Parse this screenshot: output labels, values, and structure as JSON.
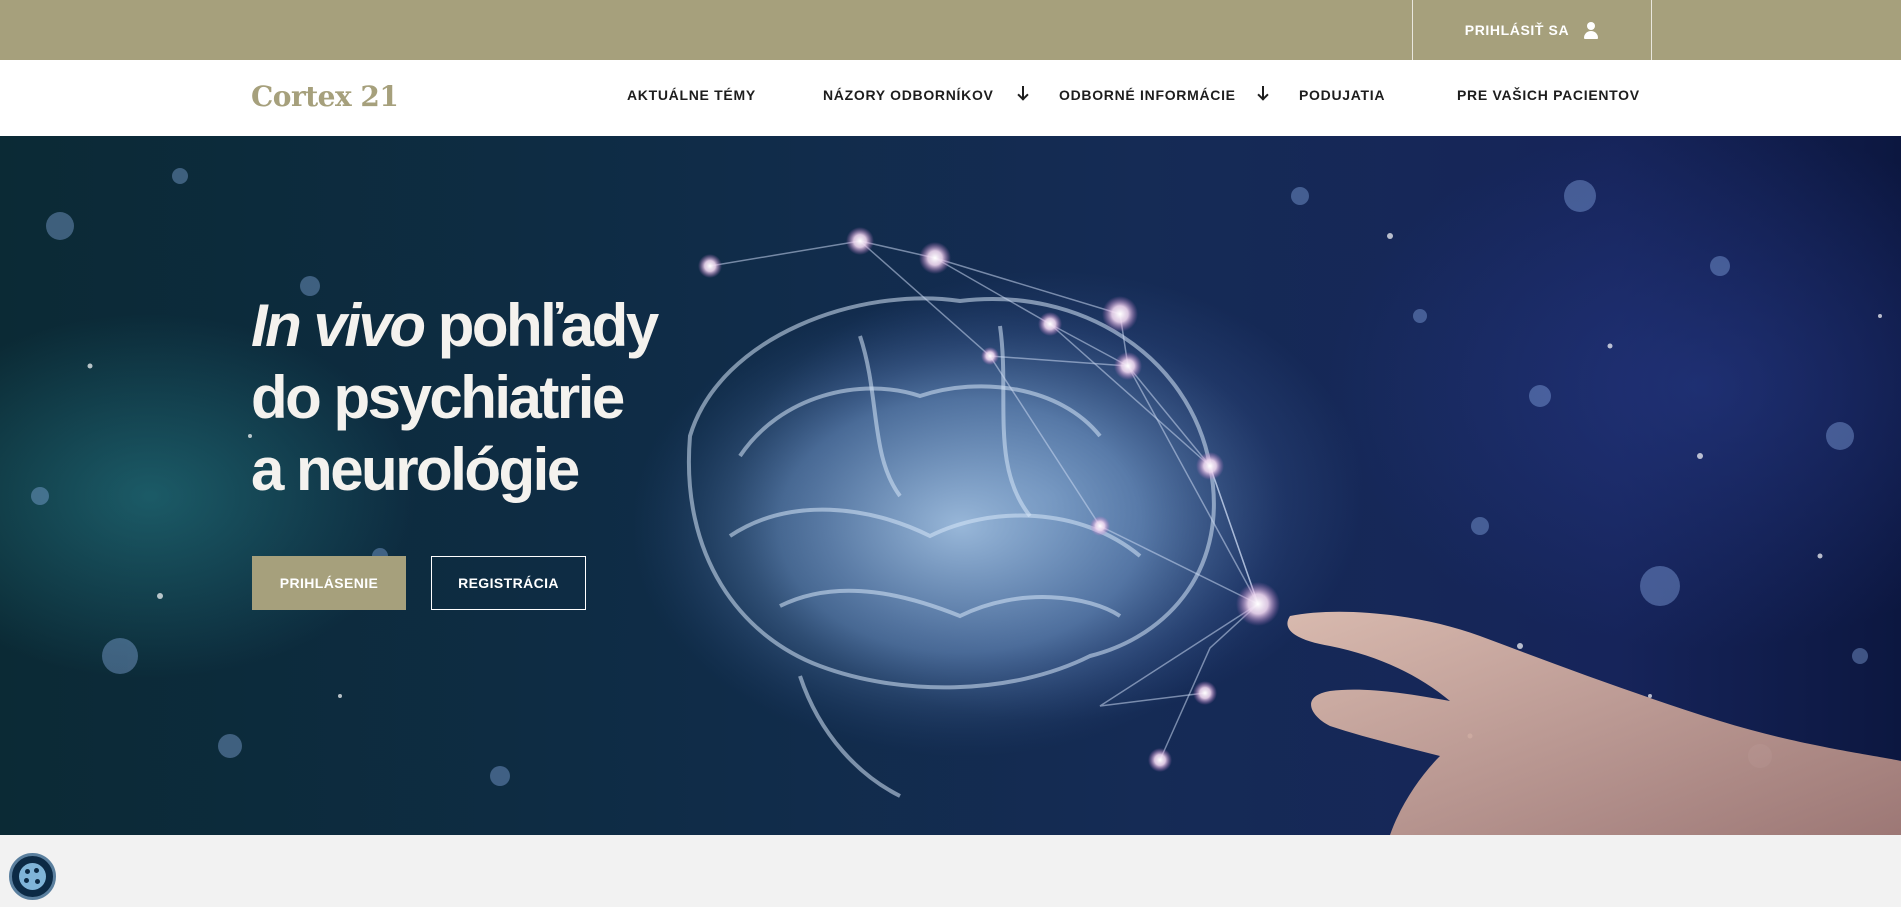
{
  "topbar": {
    "login_label": "PRIHLÁSIŤ SA",
    "login_icon": "user-icon",
    "background_color": "#a6a07c"
  },
  "header": {
    "logo_text": "Cortex 21",
    "brand_color": "#a6a07c",
    "nav": {
      "items": [
        {
          "label": "AKTUÁLNE TÉMY",
          "has_dropdown": false
        },
        {
          "label": "NÁZORY ODBORNÍKOV",
          "has_dropdown": true
        },
        {
          "label": "ODBORNÉ INFORMÁCIE",
          "has_dropdown": true
        },
        {
          "label": "PODUJATIA",
          "has_dropdown": false
        },
        {
          "label": "PRE VAŠICH PACIENTOV",
          "has_dropdown": false
        }
      ]
    }
  },
  "hero": {
    "title_italic": "In vivo",
    "title_line1_rest": " pohľady",
    "title_line2": "do psychiatrie",
    "title_line3": "a neurológie",
    "primary_button": "PRIHLÁSENIE",
    "secondary_button": "REGISTRÁCIA",
    "background_image": "brain-network-hand-illustration"
  },
  "cookie_button": {
    "icon": "cookie-icon"
  }
}
